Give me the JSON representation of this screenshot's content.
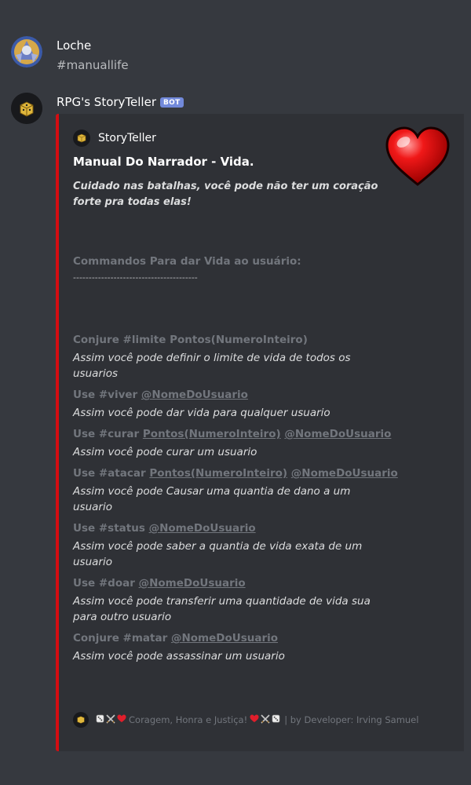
{
  "messages": [
    {
      "username": "Loche",
      "text": "#manuallife"
    },
    {
      "username": "RPG's StoryTeller",
      "bot_tag": "BOT"
    }
  ],
  "embed": {
    "accent_color": "#d40d12",
    "author": "StoryTeller",
    "title": "Manual Do Narrador - Vida.",
    "description": "Cuidado nas batalhas, você pode não ter um coração forte pra todas elas!",
    "thumbnail_icon": "heart-icon",
    "intro_field": {
      "name": "Commandos Para dar Vida ao usuário:",
      "value": "----------------------------------------"
    },
    "fields": [
      {
        "name_prefix": "Conjure #limite Pontos(NumeroInteiro)",
        "mentions": [],
        "value": "Assim você pode definir o limite de vida de todos os usuarios"
      },
      {
        "name_prefix": "Use #viver ",
        "mentions": [
          "@NomeDoUsuario"
        ],
        "value": "Assim você pode dar vida para qualquer usuario"
      },
      {
        "name_prefix": "Use #curar ",
        "mentions": [
          "Pontos(NumeroInteiro)",
          "@NomeDoUsuario"
        ],
        "value": "Assim você pode curar um usuario"
      },
      {
        "name_prefix": "Use #atacar ",
        "mentions": [
          "Pontos(NumeroInteiro)",
          "@NomeDoUsuario"
        ],
        "value": "Assim você pode Causar uma quantia de dano a um usuario"
      },
      {
        "name_prefix": "Use #status ",
        "mentions": [
          "@NomeDoUsuario"
        ],
        "value": "Assim você pode saber a quantia de vida exata de um usuario"
      },
      {
        "name_prefix": "Use #doar ",
        "mentions": [
          "@NomeDoUsuario"
        ],
        "value": "Assim você pode transferir uma quantidade de vida sua para outro usuario"
      },
      {
        "name_prefix": "Conjure #matar ",
        "mentions": [
          "@NomeDoUsuario"
        ],
        "value": "Assim você pode assassinar um usuario"
      }
    ],
    "footer": {
      "text": "Coragem, Honra e Justiça!",
      "suffix": "| by Developer: Irving Samuel"
    }
  }
}
